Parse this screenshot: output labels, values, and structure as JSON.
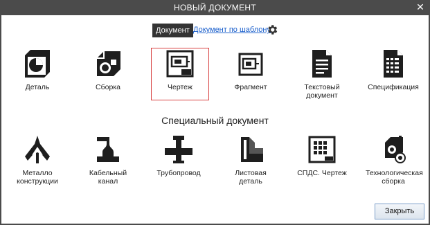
{
  "window": {
    "title": "НОВЫЙ ДОКУМЕНТ",
    "close_glyph": "✕"
  },
  "tabs": {
    "active": "Документ",
    "template_link": "Документ по шаблону"
  },
  "documents": [
    {
      "label": "Деталь",
      "icon": "part-icon"
    },
    {
      "label": "Сборка",
      "icon": "assembly-icon"
    },
    {
      "label": "Чертеж",
      "icon": "drawing-icon",
      "selected": true
    },
    {
      "label": "Фрагмент",
      "icon": "fragment-icon"
    },
    {
      "label": "Текстовый документ",
      "icon": "text-document-icon"
    },
    {
      "label": "Спецификация",
      "icon": "specification-icon"
    }
  ],
  "special": {
    "title": "Специальный документ",
    "items": [
      {
        "label": "Металло конструкции",
        "icon": "metal-structures-icon"
      },
      {
        "label": "Кабельный канал",
        "icon": "cable-channel-icon"
      },
      {
        "label": "Трубопровод",
        "icon": "pipeline-icon"
      },
      {
        "label": "Листовая деталь",
        "icon": "sheet-metal-icon"
      },
      {
        "label": "СПДС. Чертеж",
        "icon": "spds-drawing-icon"
      },
      {
        "label": "Технологическая сборка",
        "icon": "technological-assembly-icon"
      }
    ]
  },
  "footer": {
    "close_label": "Закрыть"
  },
  "colors": {
    "titlebar": "#4b4b4b",
    "accent_link": "#1a5fcc",
    "selection_border": "#d84040",
    "icon": "#1e1e1e"
  }
}
